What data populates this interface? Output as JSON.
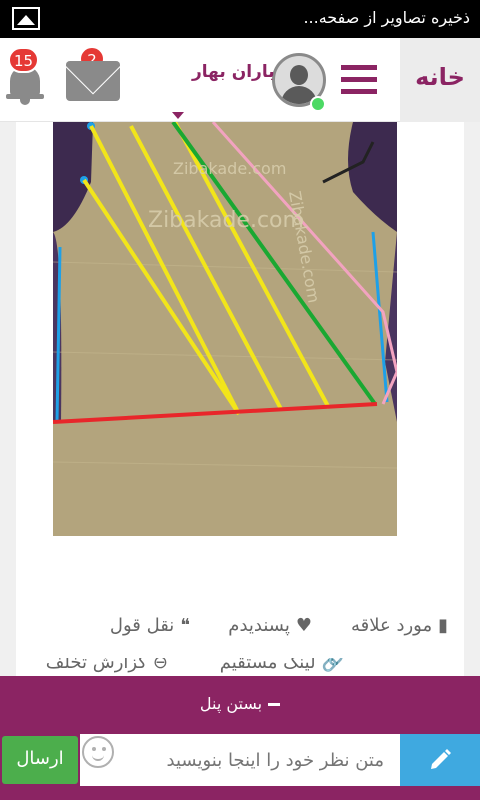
{
  "status_bar": {
    "notification_text": "ذخیره تصاویر از صفحه..."
  },
  "header": {
    "home_label": "خانه",
    "user_name": "باران بهار",
    "mail_count": "2",
    "notification_count": "15"
  },
  "image": {
    "watermark_1": "Zibakade.com",
    "watermark_2": "Zibakade.com",
    "watermark_3": "Zibakade.com"
  },
  "actions": {
    "favorite": "مورد علاقه",
    "like": "پسندیدم",
    "quote": "نقل قول",
    "permalink": "لینک مستقیم",
    "report": "گزارش تخلف"
  },
  "panel": {
    "close_label": "بستن پنل",
    "comment_placeholder": "متن نظر خود را اینجا بنویسید",
    "send_label": "ارسال"
  },
  "colors": {
    "brand": "#8b2463",
    "send": "#4cae4c",
    "edit": "#3fa9e0",
    "badge": "#e53935"
  }
}
